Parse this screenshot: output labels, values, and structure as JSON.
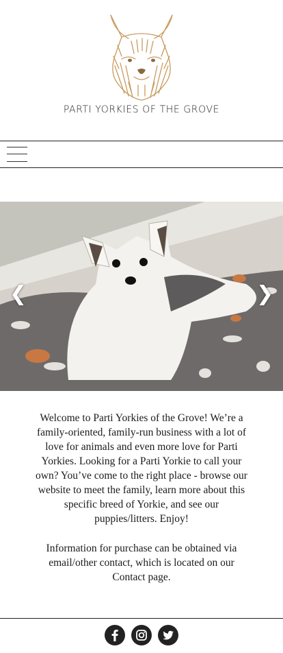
{
  "site": {
    "title": "PARTI YORKIES OF THE GROVE",
    "brand_color": "#c89a5e"
  },
  "nav": {
    "menu_icon": "hamburger-menu-icon"
  },
  "slider": {
    "prev_label": "❮",
    "next_label": "❯"
  },
  "content": {
    "welcome": "Welcome to Parti Yorkies of the Grove! We’re a family-oriented, family-run business with a lot of love for animals and even more love for Parti Yorkies. Looking for a Parti Yorkie to call your own? You’ve come to the right place - browse our website to meet the family, learn more about this specific breed of Yorkie, and see our puppies/litters. Enjoy!",
    "info_prefix": "Information for purchase can be obtained via email/other contact, which is located on our ",
    "info_link": "Contact",
    "info_suffix": " page."
  },
  "social": {
    "icons": [
      "facebook-icon",
      "instagram-icon",
      "twitter-icon"
    ]
  }
}
